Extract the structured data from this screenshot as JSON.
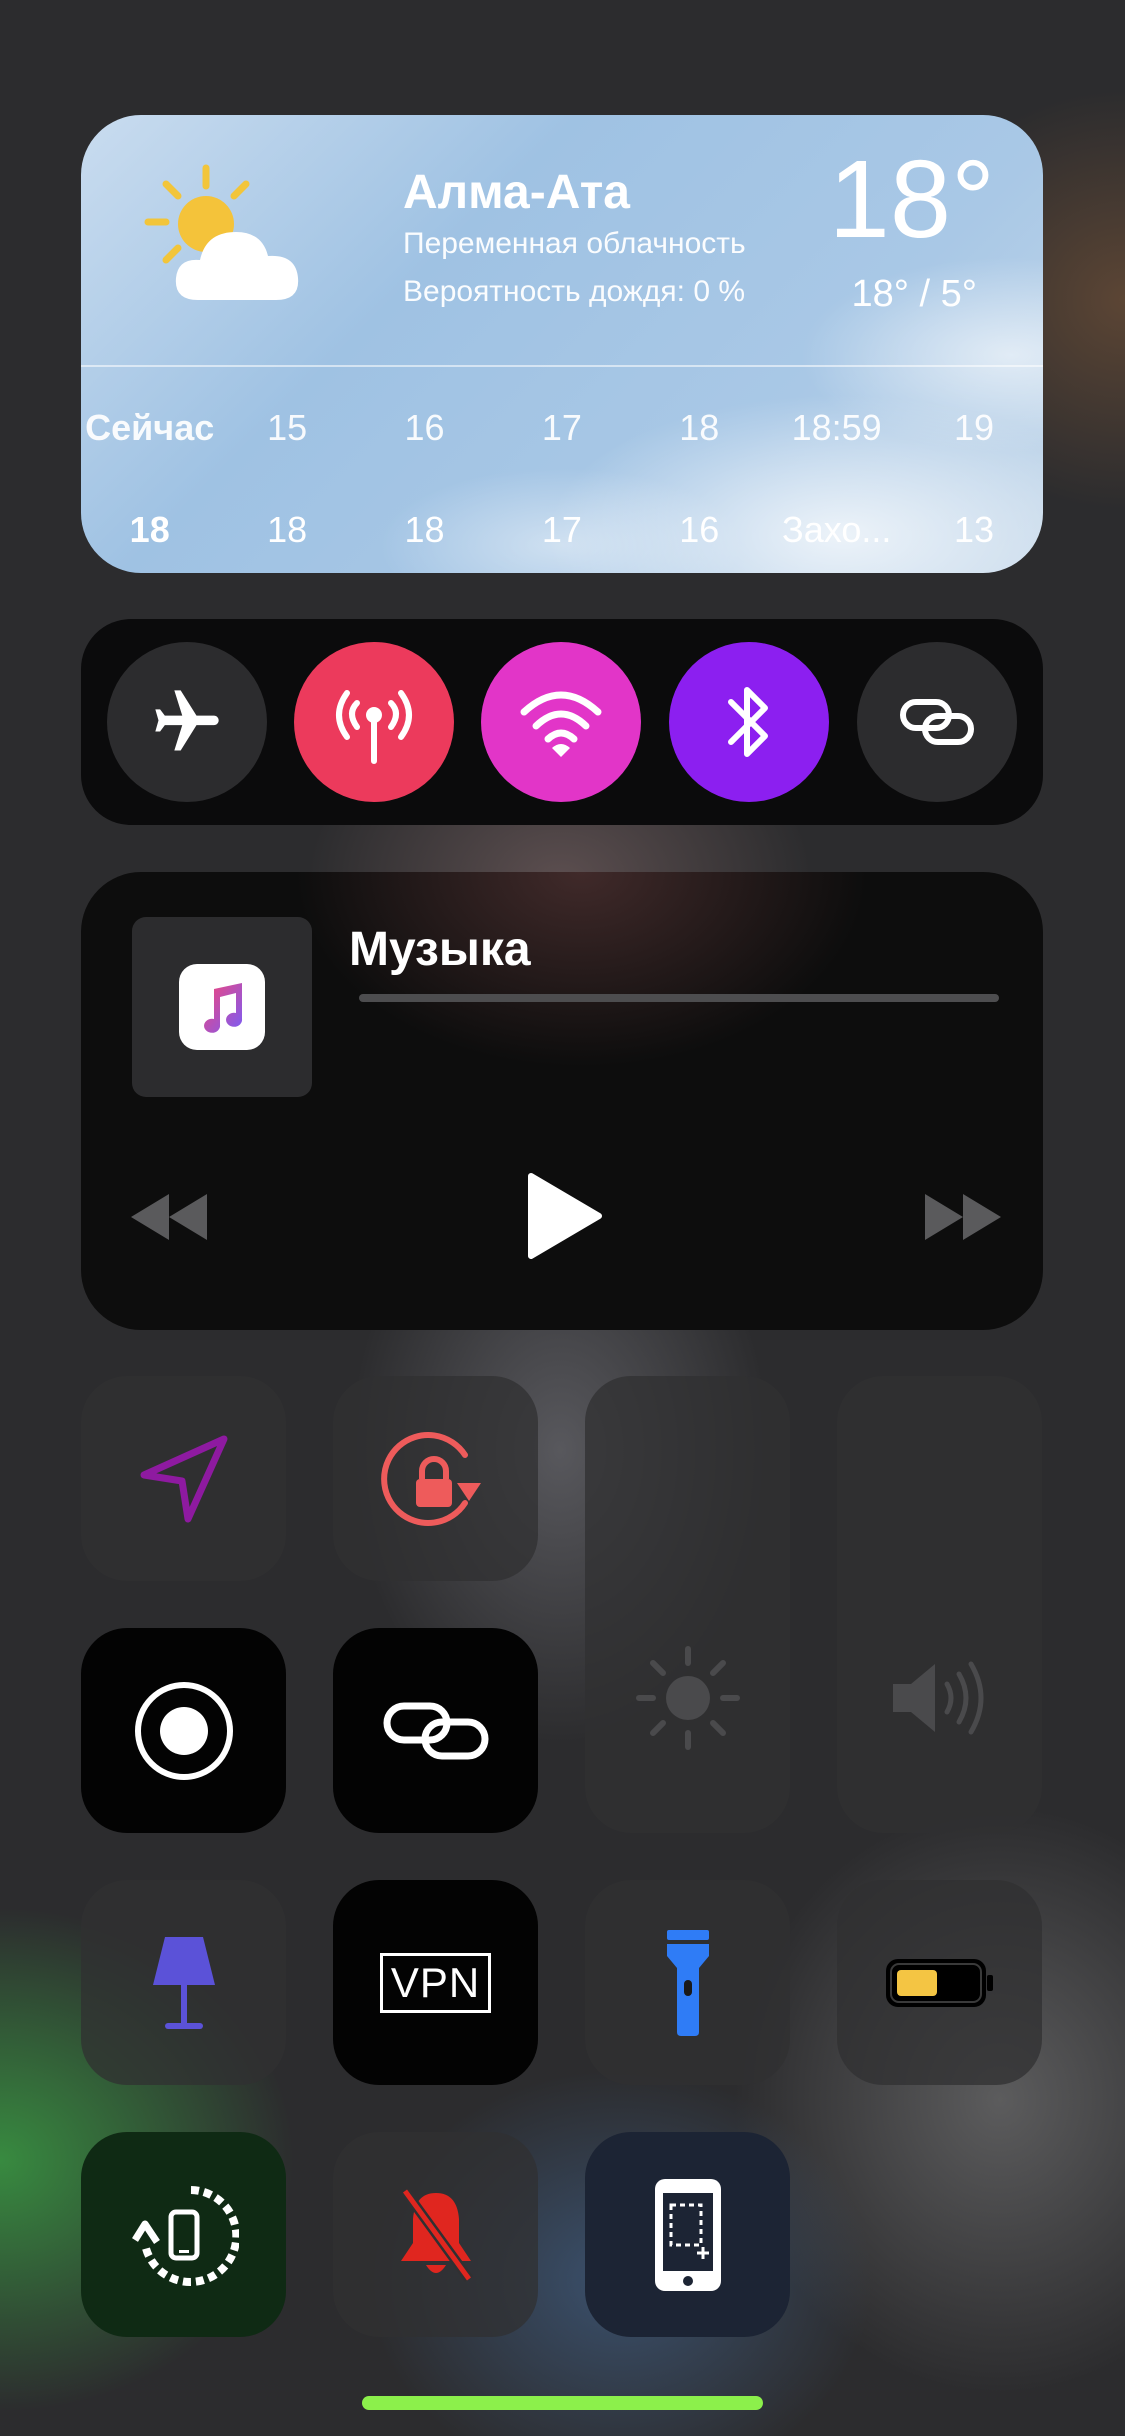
{
  "weather": {
    "city": "Алма-Ата",
    "condition": "Переменная облачность",
    "rain_chance": "Вероятность дождя: 0 %",
    "temperature": "18°",
    "high_low": "18° / 5°",
    "icon": "partly-cloudy-icon",
    "hourly": [
      {
        "time": "Сейчас",
        "value": "18"
      },
      {
        "time": "15",
        "value": "18"
      },
      {
        "time": "16",
        "value": "18"
      },
      {
        "time": "17",
        "value": "17"
      },
      {
        "time": "18",
        "value": "16"
      },
      {
        "time": "18:59",
        "value": "Захо..."
      },
      {
        "time": "19",
        "value": "13"
      }
    ]
  },
  "connectivity": [
    {
      "name": "airplane-mode",
      "icon": "airplane-icon",
      "active": false,
      "color": "#2c2c2e"
    },
    {
      "name": "cellular-data",
      "icon": "antenna-icon",
      "active": true,
      "color": "#ec3a5c"
    },
    {
      "name": "wifi",
      "icon": "wifi-icon",
      "active": true,
      "color": "#e235c8"
    },
    {
      "name": "bluetooth",
      "icon": "bluetooth-icon",
      "active": true,
      "color": "#8c1ff0"
    },
    {
      "name": "personal-hotspot",
      "icon": "link-icon",
      "active": false,
      "color": "#2c2c2e"
    }
  ],
  "music": {
    "title": "Музыка",
    "app_icon": "music-note-icon"
  },
  "controls": {
    "location_icon": "location-arrow-icon",
    "rotation_lock_icon": "rotation-lock-icon",
    "brightness_icon": "sun-icon",
    "volume_icon": "speaker-icon",
    "screen_record_icon": "record-icon",
    "link_icon": "link-icon",
    "lamp_icon": "lamp-icon",
    "vpn_label": "VPN",
    "flashlight_icon": "flashlight-icon",
    "battery_icon": "battery-icon",
    "sync_icon": "phone-sync-icon",
    "silent_icon": "bell-slash-icon",
    "screenshot_icon": "phone-screenshot-icon"
  },
  "colors": {
    "cellular": "#ec3a5c",
    "wifi": "#e235c8",
    "bluetooth": "#8c1ff0",
    "location": "#8e1aa0",
    "rotation_lock": "#ee5b5b",
    "lamp": "#5b52d8",
    "flashlight": "#2f7cf6",
    "battery": "#f4c543",
    "silent": "#e0261f",
    "home_indicator": "#8cf04b"
  }
}
